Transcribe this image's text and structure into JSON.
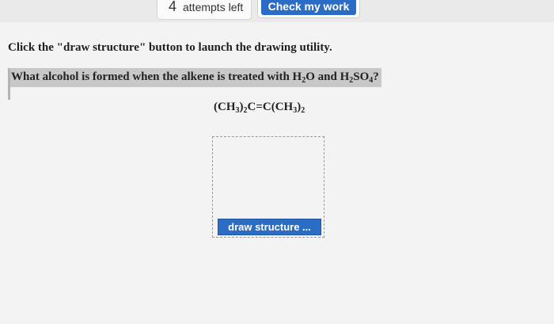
{
  "header": {
    "attempts_count": "4",
    "attempts_label": "attempts left",
    "check_button_label": "Check my work"
  },
  "main": {
    "instruction": "Click the \"draw structure\" button to launch the drawing utility.",
    "question": {
      "text_before": "What alcohol is formed when the alkene is treated with H",
      "sub1": "2",
      "text_mid": "O and H",
      "sub2": "2",
      "text_mid2": "SO",
      "sub3": "4",
      "text_after": "?"
    },
    "formula": {
      "p1": "(CH",
      "s1": "3",
      "p2": ")",
      "s2": "2",
      "p3": "C=C(CH",
      "s3": "3",
      "p4": ")",
      "s4": "2"
    },
    "draw_button_label": "draw structure ..."
  },
  "colors": {
    "accent": "#2b6cc4",
    "question_background": "#c8c8c8",
    "page_background": "#f4f3f3"
  }
}
